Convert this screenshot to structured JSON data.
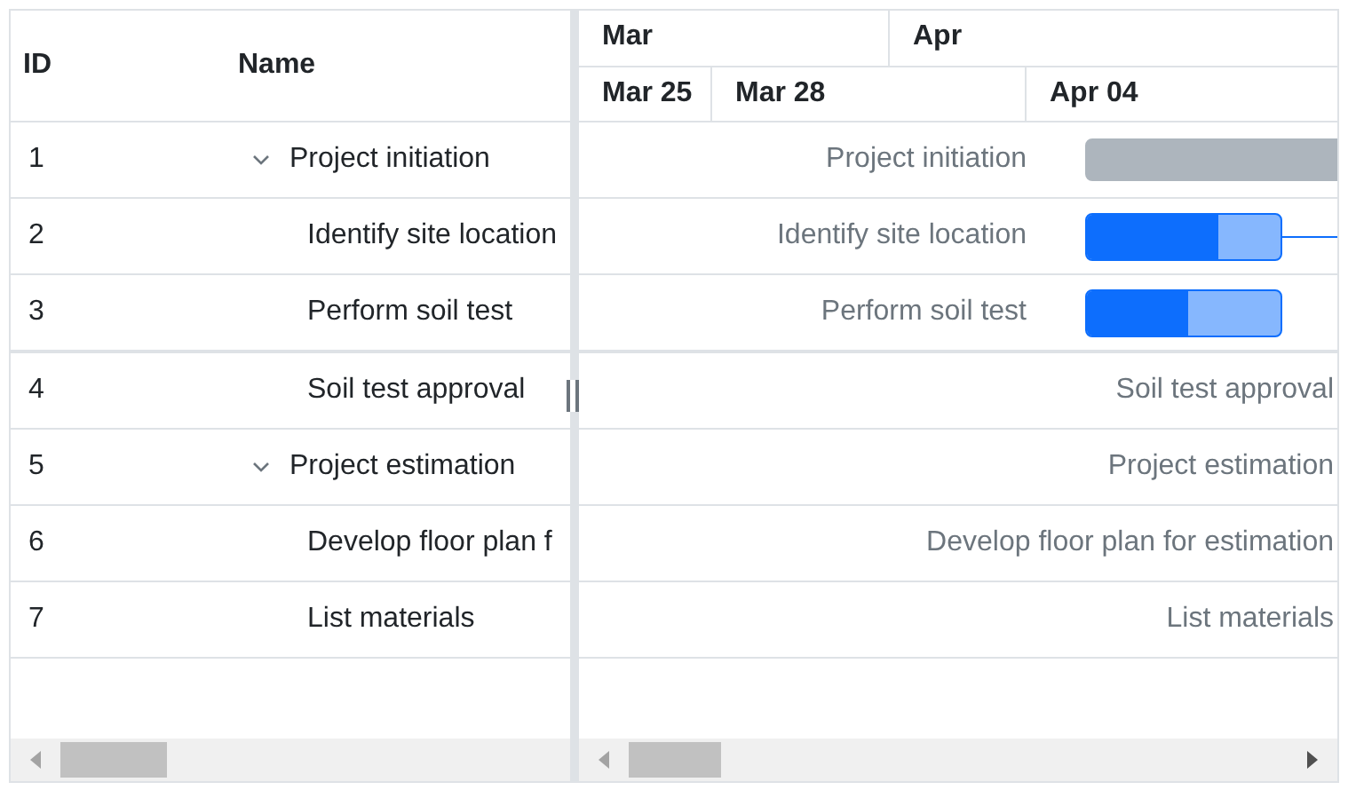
{
  "grid": {
    "columns": [
      "ID",
      "Name"
    ],
    "rows": [
      {
        "id": "1",
        "name": "Project initiation",
        "expanded": true,
        "children": [
          {
            "id": "2",
            "name": "Identify site location"
          },
          {
            "id": "3",
            "name": "Perform soil test"
          },
          {
            "id": "4",
            "name": "Soil test approval"
          }
        ]
      },
      {
        "id": "5",
        "name": "Project estimation",
        "expanded": true,
        "children": [
          {
            "id": "6",
            "name": "Develop floor plan f"
          },
          {
            "id": "7",
            "name": "List materials"
          }
        ]
      }
    ]
  },
  "timeline": {
    "months": [
      "Mar",
      "Apr"
    ],
    "weeks": [
      "Mar 25",
      "Mar 28",
      "Apr 04"
    ]
  },
  "chart_rows": [
    {
      "label": "Project initiation",
      "bar": {
        "kind": "summary"
      }
    },
    {
      "label": "Identify site location",
      "bar": {
        "kind": "progress",
        "level": 0.68,
        "link": true
      }
    },
    {
      "label": "Perform soil test",
      "bar": {
        "kind": "progress",
        "level": 0.52,
        "link": false
      }
    },
    {
      "label": "Soil test approval"
    },
    {
      "label": "Project estimation"
    },
    {
      "label": "Develop floor plan for estimation"
    },
    {
      "label": "List materials"
    }
  ]
}
